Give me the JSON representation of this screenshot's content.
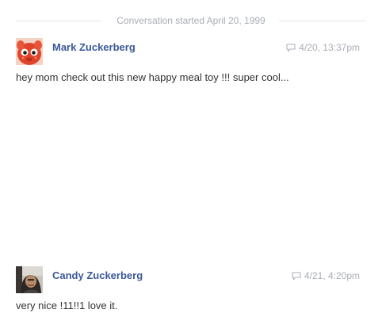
{
  "conversation": {
    "started_label": "Conversation started April 20, 1999"
  },
  "messages": [
    {
      "sender": "Mark Zuckerberg",
      "timestamp": "4/20, 13:37pm",
      "text": "hey mom check out this new happy meal toy !!! super cool...",
      "avatar": "red-cartoon-toy-avatar",
      "timestamp_icon": "chat-bubble-icon"
    },
    {
      "sender": "Candy Zuckerberg",
      "timestamp": "4/21, 4:20pm",
      "text": "very nice !11!!1 love it.",
      "avatar": "person-photo-avatar",
      "timestamp_icon": "chat-bubble-icon"
    }
  ],
  "colors": {
    "sender_link": "#3b5998",
    "meta_gray": "#a9adb5",
    "body_text": "#333333",
    "divider": "#e3e5ea"
  }
}
